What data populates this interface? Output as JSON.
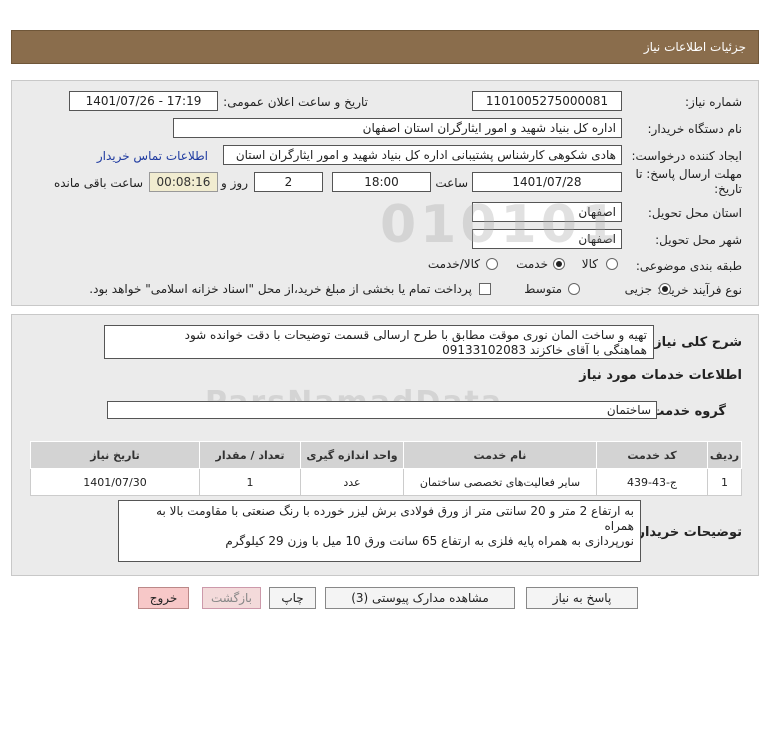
{
  "header": {
    "title": "جزئیات اطلاعات نیاز"
  },
  "labels": {
    "need_number": "شماره نیاز:",
    "announce_datetime": "تاریخ و ساعت اعلان عمومی:",
    "buyer_org": "نام دستگاه خریدار:",
    "requester": "ایجاد کننده درخواست:",
    "contact_link": "اطلاعات تماس خریدار",
    "deadline": "مهلت ارسال پاسخ: تا تاریخ:",
    "time_word": "ساعت",
    "days_word": "روز و",
    "remaining": "ساعت باقی مانده",
    "province": "استان محل تحویل:",
    "city": "شهر محل تحویل:",
    "category": "طبقه بندی موضوعی:",
    "process": "نوع فرآیند خرید :",
    "general_desc": "شرح کلی نیاز:",
    "services_info": "اطلاعات خدمات مورد نیاز",
    "service_group": "گروه خدمت:",
    "buyer_notes": "توضیحات خریدار:"
  },
  "values": {
    "need_number": "1101005275000081",
    "announce_datetime": "1401/07/26 - 17:19",
    "buyer_org": "اداره کل بنیاد شهید و امور ایثارگران استان اصفهان",
    "requester": "هادی شکوهی کارشناس پشتیبانی اداره کل بنیاد شهید و امور ایثارگران استان",
    "deadline_date": "1401/07/28",
    "deadline_time": "18:00",
    "days": "2",
    "remaining_time": "00:08:16",
    "province": "اصفهان",
    "city": "اصفهان",
    "service_group": "ساختمان",
    "general_desc_line1": "تهیه و ساخت المان نوری موقت مطابق با طرح ارسالی قسمت توضیحات با دقت خوانده شود",
    "general_desc_line2": "هماهنگی با آقای خاکزند 09133102083",
    "buyer_notes_line1": "به ارتفاع 2 متر و 20 سانتی متر از ورق فولادی برش لیزر خورده با رنگ صنعتی با مقاومت بالا به همراه",
    "buyer_notes_line2": "نورپردازی به همراه پایه فلزی به ارتفاع 65 سانت ورق 10 میل با وزن 29 کیلوگرم"
  },
  "category_options": [
    {
      "label": "کالا",
      "selected": false
    },
    {
      "label": "خدمت",
      "selected": true
    },
    {
      "label": "کالا/خدمت",
      "selected": false
    }
  ],
  "process_options": [
    {
      "label": "جزیی",
      "selected": true
    },
    {
      "label": "متوسط",
      "selected": false
    }
  ],
  "payment_note": "پرداخت تمام یا بخشی از مبلغ خرید،از محل \"اسناد خزانه اسلامی\" خواهد بود.",
  "table": {
    "headers": [
      "ردیف",
      "کد خدمت",
      "نام خدمت",
      "واحد اندازه گیری",
      "تعداد / مقدار",
      "تاریخ نیاز"
    ],
    "rows": [
      [
        "1",
        "ج-43-439",
        "سایر فعالیت‌های تخصصی ساختمان",
        "عدد",
        "1",
        "1401/07/30"
      ]
    ]
  },
  "buttons": {
    "reply": "پاسخ به نیاز",
    "docs": "مشاهده مدارک پیوستی (3)",
    "print": "چاپ",
    "back": "بازگشت",
    "exit": "خروج"
  },
  "colors": {
    "header_bg": "#8a6d4c",
    "panel_bg": "#ebebeb",
    "link": "#1e3aa0",
    "exit_btn": "#f7c8c8"
  }
}
